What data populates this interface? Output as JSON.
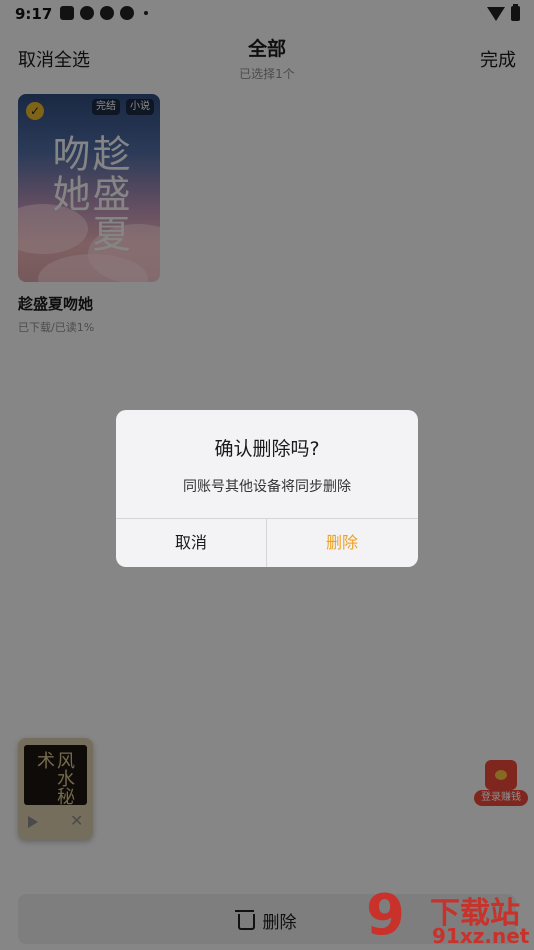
{
  "status_bar": {
    "time": "9:17"
  },
  "header": {
    "left_action": "取消全选",
    "title": "全部",
    "subtitle": "已选择1个",
    "right_action": "完成"
  },
  "book": {
    "cover_text": "趁盛夏吻她",
    "tag_status": "完结",
    "tag_type": "小说",
    "title": "趁盛夏吻她",
    "meta": "已下载/已读1%"
  },
  "mini_player": {
    "cover_text": "风水秘术"
  },
  "red_packet": {
    "label": "登录赚钱"
  },
  "bottom": {
    "delete_label": "删除"
  },
  "dialog": {
    "title": "确认删除吗?",
    "message": "同账号其他设备将同步删除",
    "cancel_label": "取消",
    "confirm_label": "删除",
    "confirm_color": "#f0a020"
  },
  "watermark": {
    "big": "9",
    "cn": "下载站",
    "url": "91xz.net"
  }
}
